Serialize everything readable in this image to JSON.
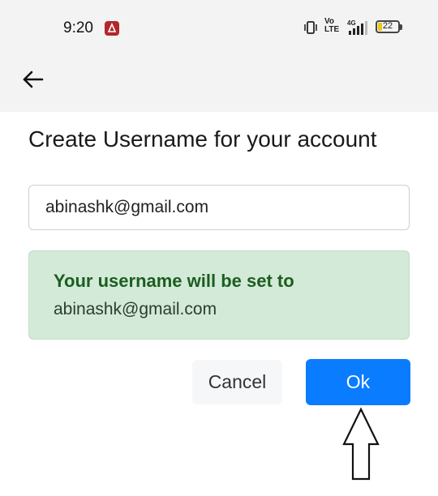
{
  "status_bar": {
    "time": "9:20",
    "volte_text": "Vo LTE",
    "network_type": "4G",
    "battery_level": "22",
    "battery_fill_percent": 22
  },
  "app_bar": {
    "back_icon": "arrow-left-icon"
  },
  "page": {
    "title": "Create Username for your account"
  },
  "username_input": {
    "value": "abinashk@gmail.com"
  },
  "info_box": {
    "message": "Your username will be set to",
    "username": "abinashk@gmail.com",
    "background_color": "#d4ead8",
    "text_color": "#1b5e20"
  },
  "actions": {
    "cancel_label": "Cancel",
    "ok_label": "Ok",
    "ok_color": "#0a7cff"
  },
  "annotation": {
    "icon": "up-arrow-icon"
  }
}
